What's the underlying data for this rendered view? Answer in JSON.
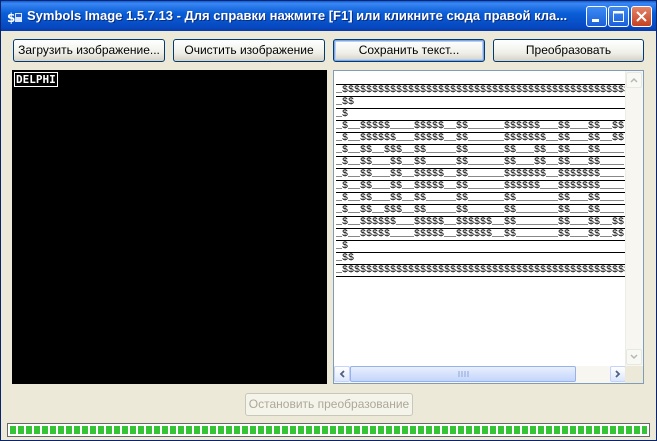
{
  "window": {
    "title": "Symbols Image 1.5.7.13 - Для справки нажмите [F1] или кликните сюда правой кла..."
  },
  "toolbar": {
    "load_label": "Загрузить изображение...",
    "clear_label": "Очистить изображение",
    "save_label": "Сохранить текст...",
    "convert_label": "Преобразовать"
  },
  "image_panel": {
    "caption": "DELPHI"
  },
  "text_output": {
    "lines": [
      "",
      "_$$$$$$$$$$$$$$$$$$$$$$$$$$$$$$$$$$$$$$$$$$$$$$$$",
      "_$$",
      "_$",
      "_$__$$$$$____$$$$$__$$______$$$$$$___$$___$$__$$",
      "_$__$$$$$$___$$$$$__$$______$$$$$$$__$$___$$__$$",
      "_$__$$__$$$__$$_____$$______$$___$$__$$___$$____",
      "_$__$$___$$__$$_____$$______$$___$$__$$___$$____",
      "_$__$$___$$__$$$$$__$$______$$$$$$$__$$$$$$$____",
      "_$__$$___$$__$$$$$__$$______$$$$$$___$$$$$$$____",
      "_$__$$___$$__$$_____$$______$$_______$$___$$____",
      "_$__$$__$$$__$$_____$$______$$_______$$___$$____",
      "_$__$$$$$$___$$$$$__$$$$$$__$$_______$$___$$__$$",
      "_$__$$$$$____$$$$$__$$$$$$__$$_______$$___$$__$$",
      "_$",
      "_$$",
      "_$$$$$$$$$$$$$$$$$$$$$$$$$$$$$$$$$$$$$$$$$$$$$$$$",
      ""
    ]
  },
  "actions": {
    "stop_label": "Остановить преобразование"
  },
  "progress": {
    "value_percent": 100
  },
  "colors": {
    "titlebar": "#0a5fd8",
    "progress_fill": "#35c435",
    "window_bg": "#ece9d8"
  }
}
